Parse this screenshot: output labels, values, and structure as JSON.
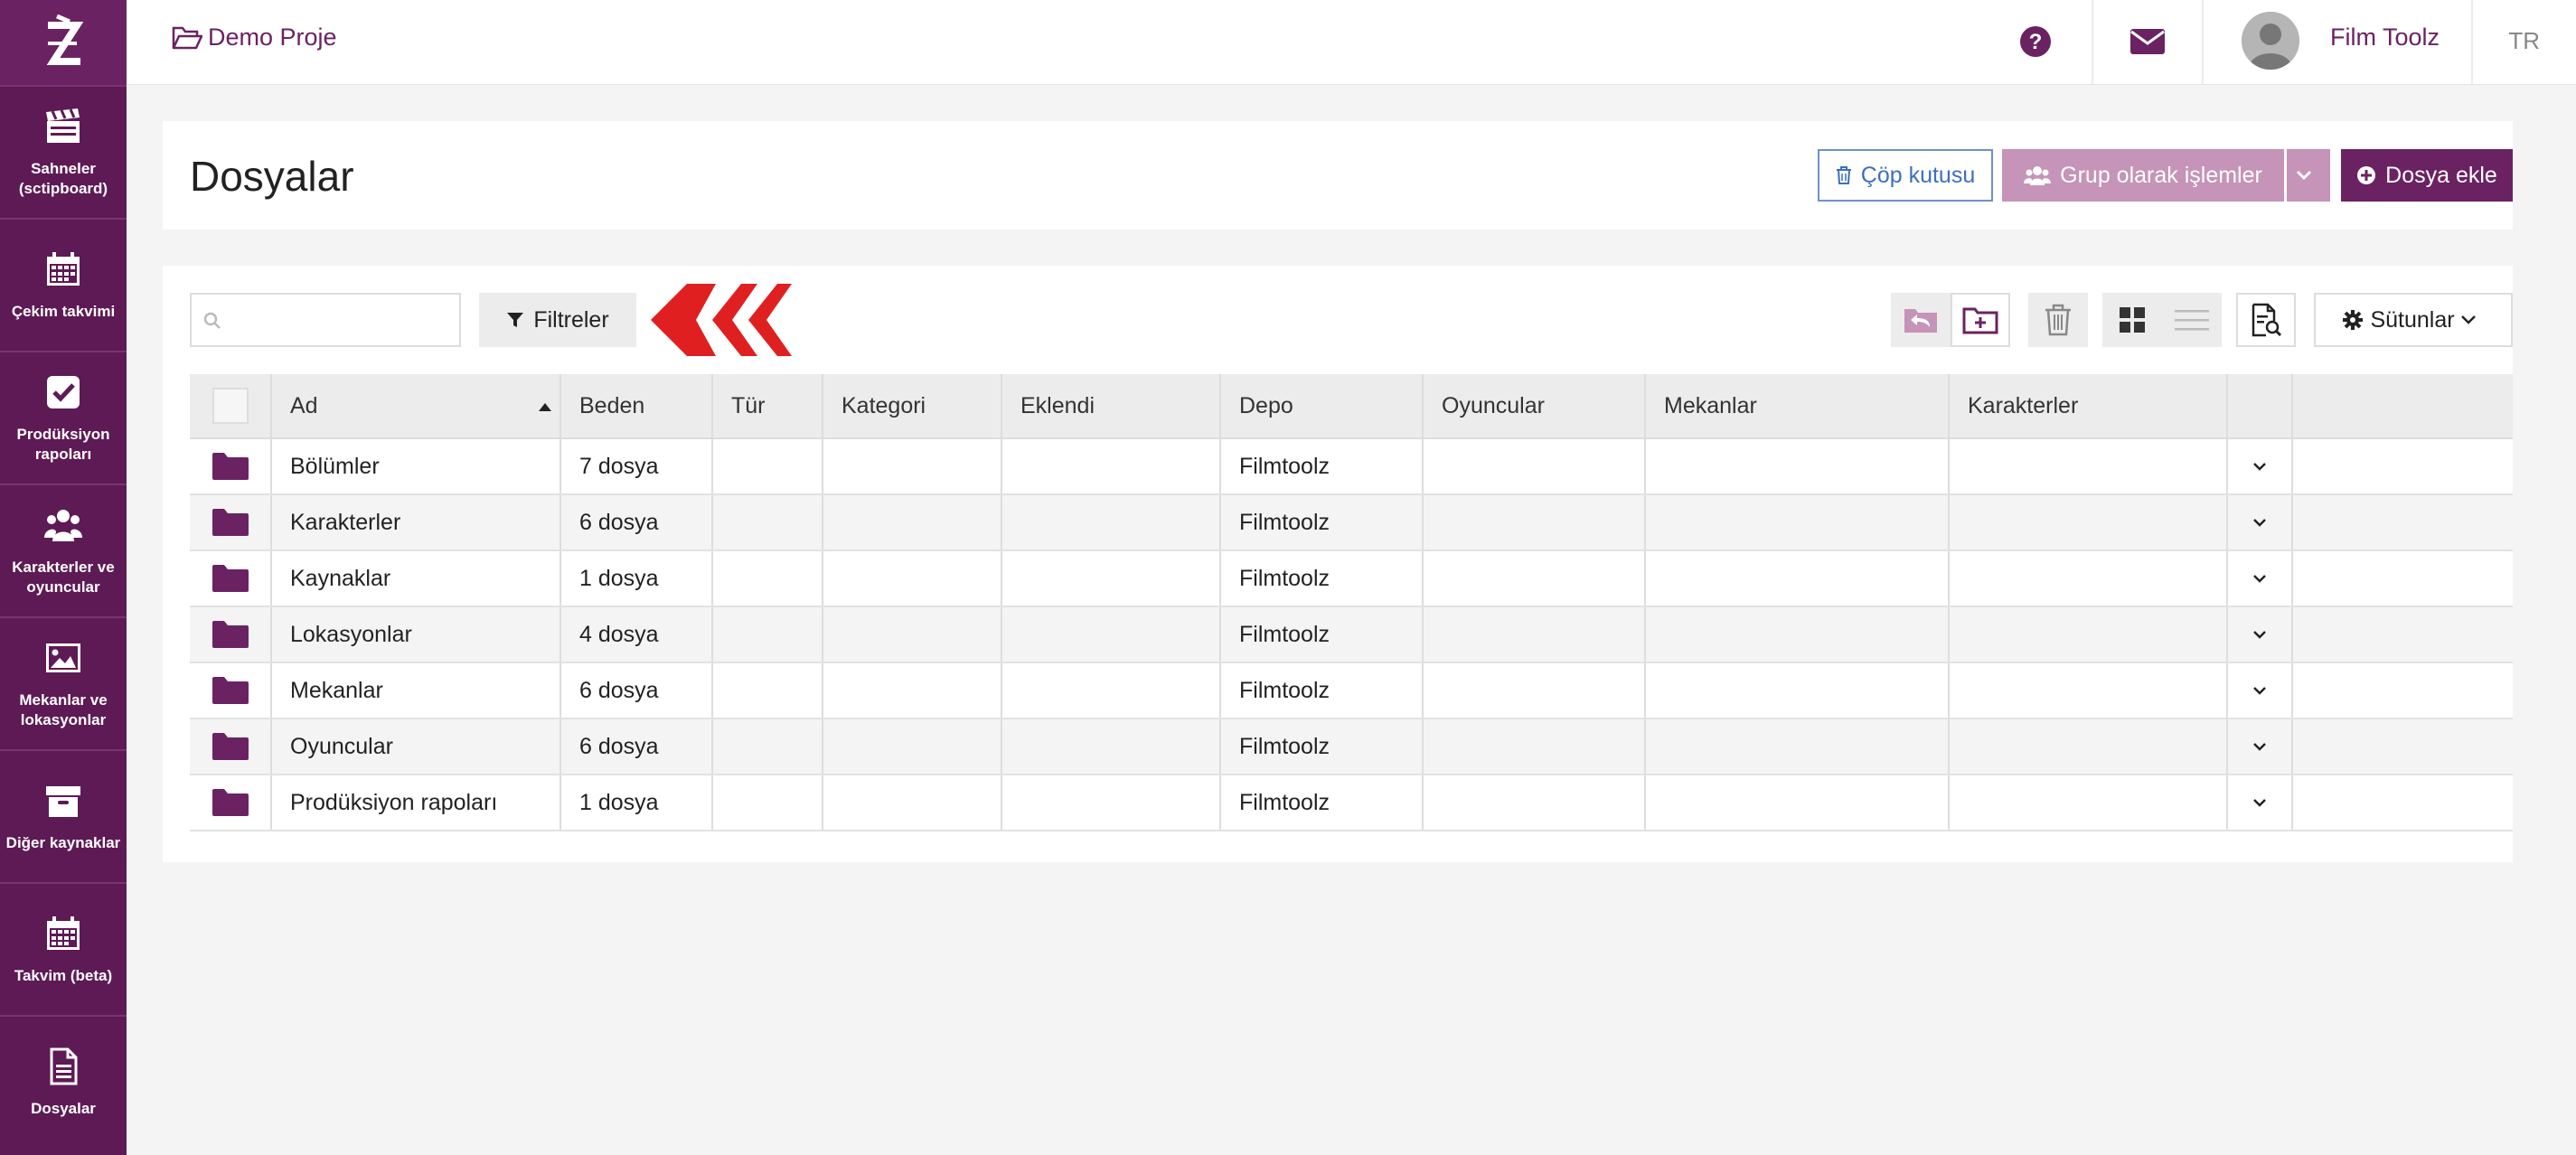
{
  "topbar": {
    "breadcrumb": "Demo Proje",
    "user_name": "Film Toolz",
    "language": "TR"
  },
  "sidebar": {
    "items": [
      {
        "label": "Sahneler (sctipboard)",
        "icon": "clapperboard-icon"
      },
      {
        "label": "Çekim takvimi",
        "icon": "calendar-icon"
      },
      {
        "label": "Prodüksiyon rapoları",
        "icon": "checkbox-icon"
      },
      {
        "label": "Karakterler ve oyuncular",
        "icon": "users-icon"
      },
      {
        "label": "Mekanlar ve lokasyonlar",
        "icon": "image-icon"
      },
      {
        "label": "Diğer kaynaklar",
        "icon": "archive-icon"
      },
      {
        "label": "Takvim (beta)",
        "icon": "calendar-icon"
      },
      {
        "label": "Dosyalar",
        "icon": "file-icon"
      }
    ]
  },
  "header": {
    "title": "Dosyalar",
    "trash_label": "Çöp kutusu",
    "group_label": "Grup olarak işlemler",
    "add_label": "Dosya ekle"
  },
  "toolbar": {
    "search_placeholder": "",
    "filter_label": "Filtreler",
    "columns_label": "Sütunlar"
  },
  "table": {
    "columns": [
      "Ad",
      "Beden",
      "Tür",
      "Kategori",
      "Eklendi",
      "Depo",
      "Oyuncular",
      "Mekanlar",
      "Karakterler"
    ],
    "rows": [
      {
        "name": "Bölümler",
        "size": "7 dosya",
        "type": "",
        "category": "",
        "added": "",
        "storage": "Filmtoolz",
        "actors": "",
        "locations": "",
        "characters": ""
      },
      {
        "name": "Karakterler",
        "size": "6 dosya",
        "type": "",
        "category": "",
        "added": "",
        "storage": "Filmtoolz",
        "actors": "",
        "locations": "",
        "characters": ""
      },
      {
        "name": "Kaynaklar",
        "size": "1 dosya",
        "type": "",
        "category": "",
        "added": "",
        "storage": "Filmtoolz",
        "actors": "",
        "locations": "",
        "characters": ""
      },
      {
        "name": "Lokasyonlar",
        "size": "4 dosya",
        "type": "",
        "category": "",
        "added": "",
        "storage": "Filmtoolz",
        "actors": "",
        "locations": "",
        "characters": ""
      },
      {
        "name": "Mekanlar",
        "size": "6 dosya",
        "type": "",
        "category": "",
        "added": "",
        "storage": "Filmtoolz",
        "actors": "",
        "locations": "",
        "characters": ""
      },
      {
        "name": "Oyuncular",
        "size": "6 dosya",
        "type": "",
        "category": "",
        "added": "",
        "storage": "Filmtoolz",
        "actors": "",
        "locations": "",
        "characters": ""
      },
      {
        "name": "Prodüksiyon rapoları",
        "size": "1 dosya",
        "type": "",
        "category": "",
        "added": "",
        "storage": "Filmtoolz",
        "actors": "",
        "locations": "",
        "characters": ""
      }
    ]
  },
  "colors": {
    "brand": "#6b2262",
    "sidebar": "#5e1a55",
    "group_button": "#c594b8",
    "trash_button": "#3c6fc0",
    "arrow_red": "#e02020"
  }
}
